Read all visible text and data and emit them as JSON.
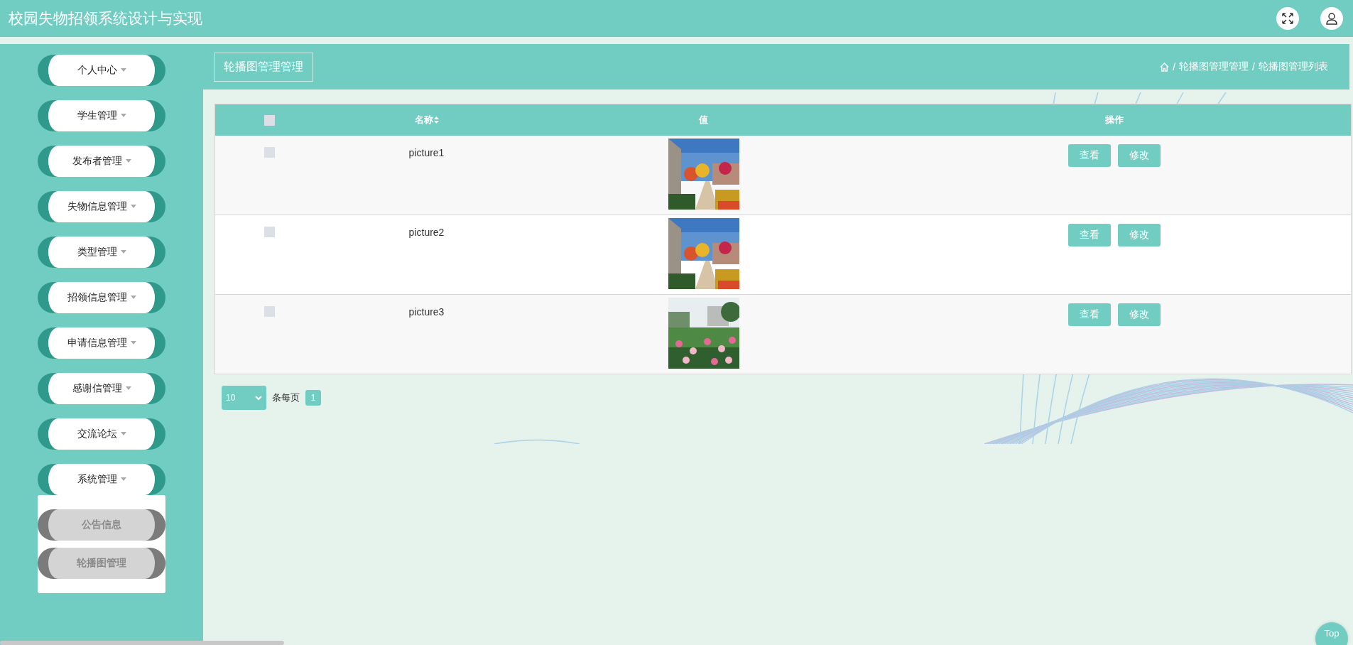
{
  "header": {
    "title": "校园失物招领系统设计与实现"
  },
  "sidebar": {
    "items": [
      {
        "label": "个人中心"
      },
      {
        "label": "学生管理"
      },
      {
        "label": "发布者管理"
      },
      {
        "label": "失物信息管理"
      },
      {
        "label": "类型管理"
      },
      {
        "label": "招领信息管理"
      },
      {
        "label": "申请信息管理"
      },
      {
        "label": "感谢信管理"
      },
      {
        "label": "交流论坛"
      },
      {
        "label": "系统管理",
        "expanded": true,
        "children": [
          {
            "label": "公告信息"
          },
          {
            "label": "轮播图管理"
          }
        ]
      }
    ]
  },
  "page_title": "轮播图管理管理",
  "breadcrumb": {
    "separator": "/",
    "items": [
      {
        "label": "轮播图管理管理"
      },
      {
        "label": "轮播图管理列表"
      }
    ]
  },
  "table": {
    "columns": [
      {
        "kind": "checkbox",
        "checked": false
      },
      {
        "kind": "text",
        "label": "名称",
        "sortable": true
      },
      {
        "kind": "text",
        "label": "值"
      },
      {
        "kind": "text",
        "label": "操作"
      }
    ],
    "rows": [
      {
        "checked": false,
        "name": "picture1",
        "value": {
          "kind": "picture"
        },
        "actions": [
          "查看",
          "修改"
        ]
      },
      {
        "checked": false,
        "name": "picture2",
        "value": {
          "kind": "picture"
        },
        "actions": [
          "查看",
          "修改"
        ]
      },
      {
        "checked": false,
        "name": "picture3",
        "value": {
          "kind": "picture"
        },
        "actions": [
          "查看",
          "修改"
        ]
      }
    ]
  },
  "pagination": {
    "page_size": "10",
    "per_page_label": "条每页",
    "pages": [
      {
        "label": "1",
        "selected": true
      }
    ]
  },
  "back_to_top": "Top"
}
